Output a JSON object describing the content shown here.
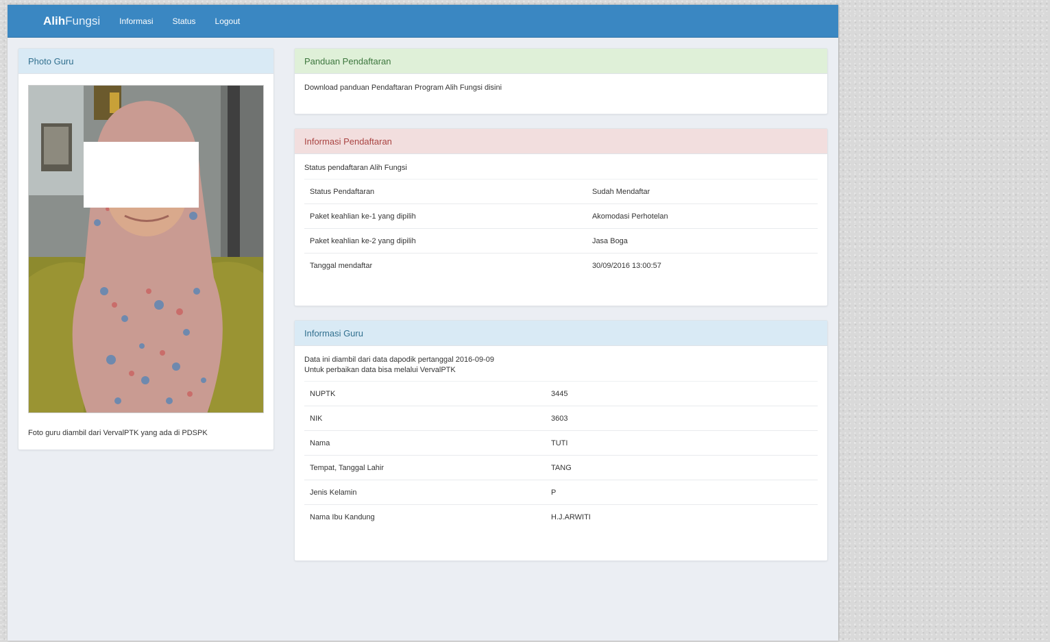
{
  "nav": {
    "brand_bold": "Alih",
    "brand_rest": "Fungsi",
    "links": [
      "Informasi",
      "Status",
      "Logout"
    ]
  },
  "photo_panel": {
    "title": "Photo Guru",
    "caption": "Foto guru diambil dari VervalPTK yang ada di PDSPK"
  },
  "panduan": {
    "title": "Panduan Pendaftaran",
    "text": "Download panduan Pendaftaran Program Alih Fungsi disini"
  },
  "pendaftaran": {
    "title": "Informasi Pendaftaran",
    "subtitle": "Status pendaftaran Alih Fungsi",
    "rows": [
      {
        "label": "Status Pendaftaran",
        "value": "Sudah Mendaftar"
      },
      {
        "label": "Paket keahlian ke-1 yang dipilih",
        "value": "Akomodasi Perhotelan"
      },
      {
        "label": "Paket keahlian ke-2 yang dipilih",
        "value": "Jasa Boga"
      },
      {
        "label": "Tanggal mendaftar",
        "value": "30/09/2016 13:00:57"
      }
    ]
  },
  "guru": {
    "title": "Informasi Guru",
    "note_line1": "Data ini diambil dari data dapodik pertanggal 2016-09-09",
    "note_line2": "Untuk perbaikan data bisa melalui VervalPTK",
    "rows": [
      {
        "label": "NUPTK",
        "value": "3445"
      },
      {
        "label": "NIK",
        "value": "3603"
      },
      {
        "label": "Nama",
        "value": "TUTI"
      },
      {
        "label": "Tempat, Tanggal Lahir",
        "value": "TANG"
      },
      {
        "label": "Jenis Kelamin",
        "value": "P"
      },
      {
        "label": "Nama Ibu Kandung",
        "value": "H.J.ARWITI"
      }
    ]
  }
}
